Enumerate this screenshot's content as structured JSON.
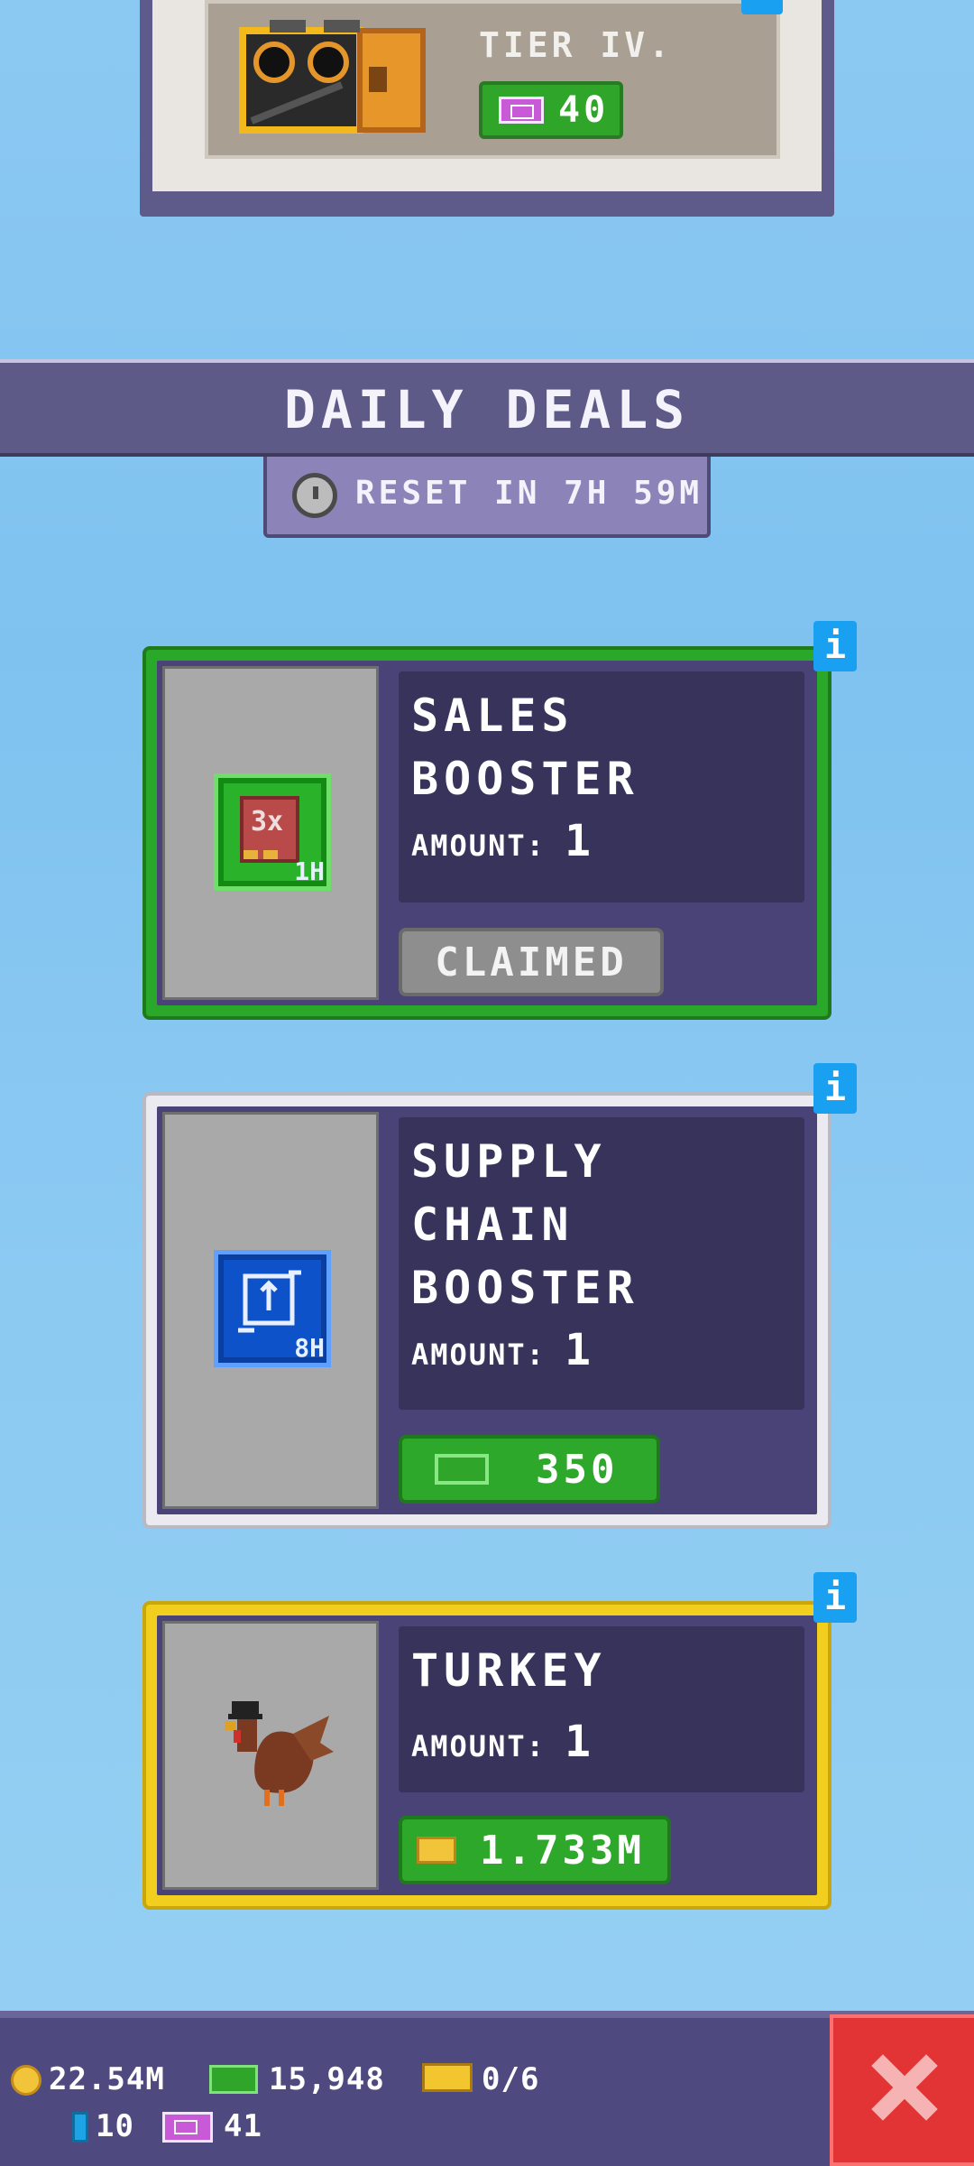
{
  "top_card": {
    "tier_label": "TIER IV.",
    "price": "40"
  },
  "daily_deals": {
    "title": "DAILY DEALS",
    "reset_text": "RESET IN 7H 59M"
  },
  "deals": [
    {
      "title_line1": "SALES",
      "title_line2": "BOOSTER",
      "amount_label": "AMOUNT:",
      "amount": "1",
      "badge": "1H",
      "multiplier": "3x",
      "button": "CLAIMED",
      "border_color": "#2aa82a"
    },
    {
      "title_line1": "SUPPLY",
      "title_line2": "CHAIN",
      "title_line3": "BOOSTER",
      "amount_label": "AMOUNT:",
      "amount": "1",
      "badge": "8H",
      "button": "350",
      "border_color": "#e8e8ee"
    },
    {
      "title_line1": "TURKEY",
      "amount_label": "AMOUNT:",
      "amount": "1",
      "button": "1.733M",
      "border_color": "#f2cf1e"
    }
  ],
  "info_label": "i",
  "bottom_bar": {
    "coins": "22.54M",
    "cash": "15,948",
    "gold": "0/6",
    "gems": "10",
    "tickets": "41"
  }
}
